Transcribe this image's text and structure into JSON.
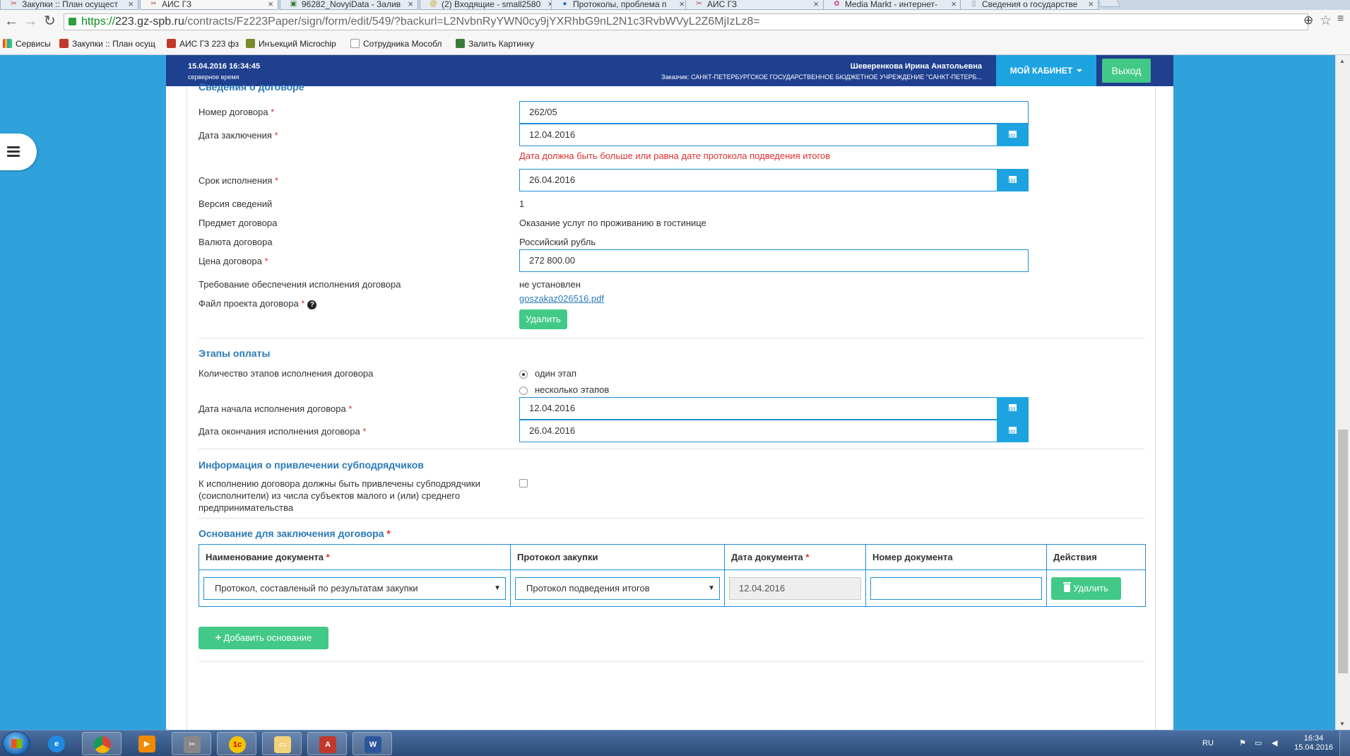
{
  "browser": {
    "tabs": [
      {
        "title": "Закупки :: План осущест",
        "fav": "✂",
        "favColor": "#c0392b"
      },
      {
        "title": "АИС ГЗ",
        "fav": "✂",
        "favColor": "#c0392b"
      },
      {
        "title": "96282_NovyiData - Залив",
        "fav": "▣",
        "favColor": "#3b7a3b"
      },
      {
        "title": "(2) Входящие - small2580",
        "fav": "@",
        "favColor": "#d49b00"
      },
      {
        "title": "Протоколы, проблема п",
        "fav": "●",
        "favColor": "#2e6db5"
      },
      {
        "title": "АИС ГЗ",
        "fav": "✂",
        "favColor": "#c0392b"
      },
      {
        "title": "Media Markt - интернет-",
        "fav": "✿",
        "favColor": "#d93d8f"
      },
      {
        "title": "Сведения о государстве",
        "fav": "▯",
        "favColor": "#888888"
      }
    ],
    "close_glyph": "×",
    "url_https": "https://",
    "url_host": "223.gz-spb.ru",
    "url_rest": "/contracts/Fz223Paper/sign/form/edit/549/?backurl=L2NvbnRyYWN0cy9jYXRhbG9nL2N1c3RvbWVyL2Z6MjIzLz8=",
    "bookmarks": [
      {
        "label": "Сервисы",
        "color": "#e74c3c"
      },
      {
        "label": "Закупки :: План осущ",
        "color": "#c0392b"
      },
      {
        "label": "АИС ГЗ 223 фз",
        "color": "#c0392b"
      },
      {
        "label": "Инъекций Microchip",
        "color": "#7a8a2a"
      },
      {
        "label": "Сотрудника Мособл",
        "color": "#aaaaaa"
      },
      {
        "label": "Залить Картинку",
        "color": "#3b7a3b"
      }
    ]
  },
  "header": {
    "datetime": "15.04.2016 16:34:45",
    "datetime_sub": "серверное время",
    "user": "Шеверенкова Ирина Анатольевна",
    "customer": "Заказчик: САНКТ-ПЕТЕРБУРГСКОЕ ГОСУДАРСТВЕННОЕ БЮДЖЕТНОЕ УЧРЕЖДЕНИЕ \"САНКТ-ПЕТЕРБ...",
    "cabinet": "МОЙ КАБИНЕТ",
    "logout": "Выход"
  },
  "contract": {
    "section_title": "Сведения о договоре",
    "number_label": "Номер договора",
    "number": "262/05",
    "date_label": "Дата заключения",
    "date": "12.04.2016",
    "date_error": "Дата должна быть больше или равна дате протокола подведения итогов",
    "term_label": "Срок исполнения",
    "term": "26.04.2016",
    "version_label": "Версия сведений",
    "version": "1",
    "subject_label": "Предмет договора",
    "subject": "Оказание услуг по проживанию в гостинице",
    "currency_label": "Валюта договора",
    "currency": "Российский рубль",
    "price_label": "Цена договора",
    "price": "272 800.00",
    "security_label": "Требование обеспечения исполнения договора",
    "security": "не установлен",
    "file_label": "Файл проекта договора",
    "file_link": "goszakaz026516.pdf",
    "delete": "Удалить",
    "required_mark": "*",
    "help_glyph": "?"
  },
  "payment": {
    "section_title": "Этапы оплаты",
    "stages_label": "Количество этапов исполнения договора",
    "option_one": "один этап",
    "option_many": "несколько этапов",
    "start_label": "Дата начала исполнения договора",
    "start": "12.04.2016",
    "end_label": "Дата окончания исполнения договора",
    "end": "26.04.2016"
  },
  "subcontractors": {
    "section_title": "Информация о привлечении субподрядчиков",
    "label": "К исполнению договора должны быть привлечены субподрядчики (соисполнители) из числа субъектов малого и (или) среднего предпринимательства"
  },
  "basis": {
    "section_title": "Основание для заключения договора",
    "columns": [
      "Наименование документа",
      "Протокол закупки",
      "Дата документа",
      "Номер документа",
      "Действия"
    ],
    "row": {
      "doc_name": "Протокол, составленый по результатам закупки",
      "protocol": "Протокол подведения итогов",
      "doc_date": "12.04.2016",
      "doc_number": "",
      "action": "Удалить"
    },
    "add_button": "Добавить основание"
  },
  "taskbar": {
    "lang": "RU",
    "time": "16:34",
    "date": "15.04.2016"
  }
}
